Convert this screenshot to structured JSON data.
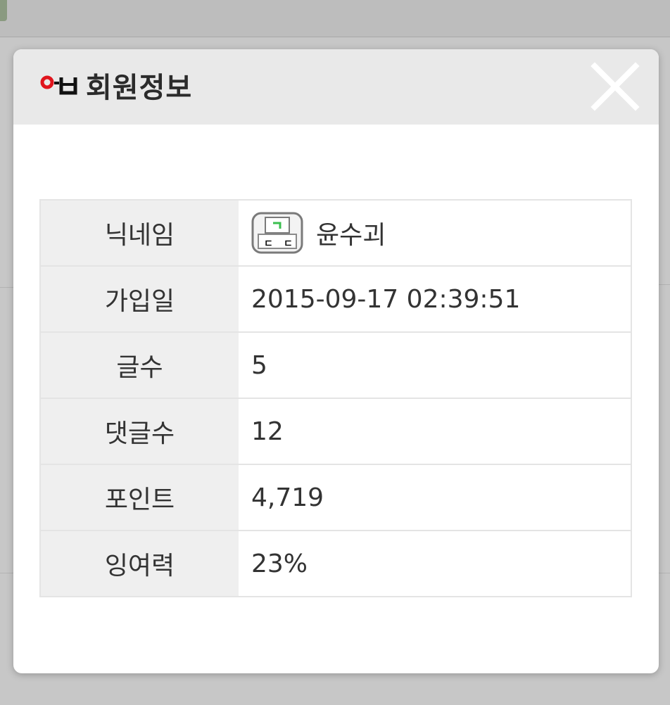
{
  "modal": {
    "title": "회원정보",
    "close_label": "×"
  },
  "member": {
    "rows": [
      {
        "label": "닉네임",
        "value": "윤수괴"
      },
      {
        "label": "가입일",
        "value": "2015-09-17 02:39:51"
      },
      {
        "label": "글수",
        "value": "5"
      },
      {
        "label": "댓글수",
        "value": "12"
      },
      {
        "label": "포인트",
        "value": "4,719"
      },
      {
        "label": "잉여력",
        "value": "23%"
      }
    ]
  },
  "colors": {
    "header_bg": "#e9e9e9",
    "label_bg": "#efefef",
    "overlay_bg": "#c7c7c7"
  }
}
